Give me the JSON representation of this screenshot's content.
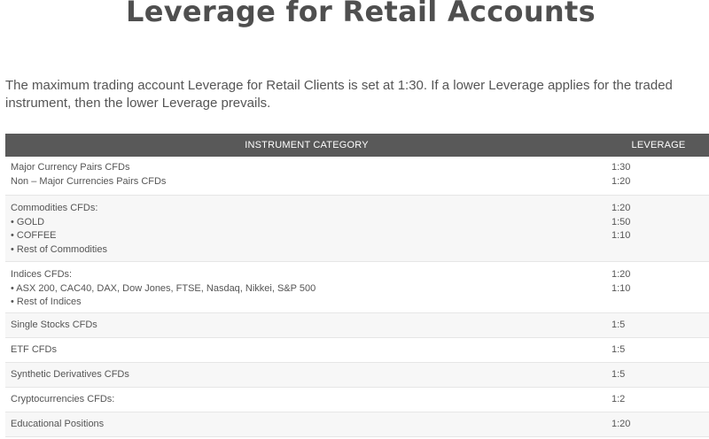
{
  "page": {
    "title": "Leverage for Retail Accounts",
    "intro": "The maximum trading account Leverage for Retail Clients is set at 1:30. If a lower Leverage applies for the traded instrument, then the lower Leverage prevails."
  },
  "table": {
    "headers": {
      "category": "INSTRUMENT CATEGORY",
      "leverage": "LEVERAGE"
    },
    "rows": [
      {
        "category": [
          "Major Currency Pairs CFDs",
          "Non – Major Currencies Pairs CFDs"
        ],
        "leverage": [
          "1:30",
          "1:20"
        ]
      },
      {
        "category": [
          "Commodities CFDs:",
          "• GOLD",
          "• COFFEE",
          "• Rest of Commodities"
        ],
        "leverage": [
          "1:20",
          "1:50",
          "1:10"
        ]
      },
      {
        "category": [
          "Indices CFDs:",
          "• ASX 200, CAC40, DAX, Dow Jones, FTSE, Nasdaq, Nikkei, S&P 500",
          "• Rest of Indices"
        ],
        "leverage": [
          "1:20",
          "1:10"
        ]
      },
      {
        "category": [
          "Single Stocks CFDs"
        ],
        "leverage": [
          "1:5"
        ]
      },
      {
        "category": [
          "ETF CFDs"
        ],
        "leverage": [
          "1:5"
        ]
      },
      {
        "category": [
          "Synthetic Derivatives CFDs"
        ],
        "leverage": [
          "1:5"
        ]
      },
      {
        "category": [
          "Cryptocurrencies CFDs:"
        ],
        "leverage": [
          "1:2"
        ]
      },
      {
        "category": [
          "Educational Positions"
        ],
        "leverage": [
          "1:20"
        ]
      }
    ]
  },
  "colors": {
    "header_bg": "#595959",
    "header_text": "#ffffff",
    "alt_row_bg": "#f7f7f7",
    "text": "#555555"
  }
}
